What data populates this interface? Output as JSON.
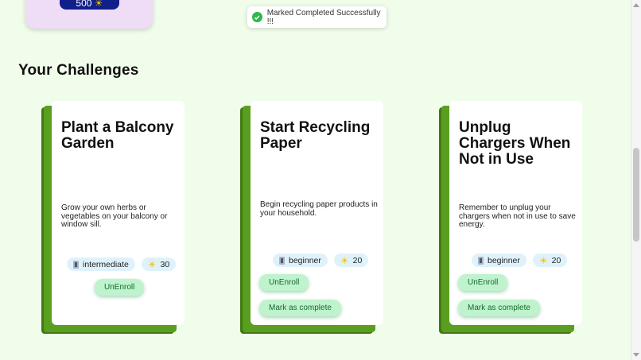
{
  "profile_card": {
    "points": "500"
  },
  "toast": {
    "message": "Marked Completed Successfully !!!"
  },
  "section": {
    "title": "Your Challenges"
  },
  "challenges": [
    {
      "title": "Plant a Balcony Garden",
      "description": "Grow your own herbs or vegetables on your balcony or window sill.",
      "level": "intermediate",
      "points": "30",
      "unenroll_label": "UnEnroll",
      "complete_label": ""
    },
    {
      "title": "Start Recycling Paper",
      "description": "Begin recycling paper products in your household.",
      "level": "beginner",
      "points": "20",
      "unenroll_label": "UnEnroll",
      "complete_label": "Mark as complete"
    },
    {
      "title": "Unplug Chargers When Not in Use",
      "description": "Remember to unplug your chargers when not in use to save energy.",
      "level": "beginner",
      "points": "20",
      "unenroll_label": "UnEnroll",
      "complete_label": "Mark as complete"
    }
  ],
  "icons": {
    "level": "level-icon",
    "points": "sun-icon",
    "toast": "check-circle-icon"
  },
  "colors": {
    "background": "#f1fdeb",
    "button": "#bff3cd",
    "card_shadow": "#3f7b12",
    "points_pill": "#101f8a"
  }
}
